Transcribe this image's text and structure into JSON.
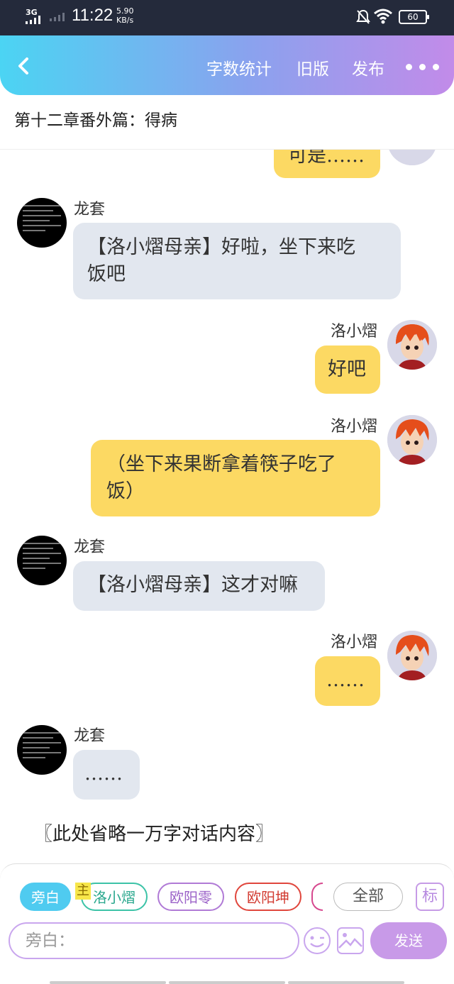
{
  "status_bar": {
    "network": "3G",
    "time": "11:22",
    "speed_value": "5.90",
    "speed_unit": "KB/s",
    "battery": "60",
    "icons": [
      "signal-icon",
      "mute-bell-icon",
      "wifi-icon",
      "battery-icon"
    ]
  },
  "header": {
    "back_icon": "chevron-left-icon",
    "word_count": "字数统计",
    "old_version": "旧版",
    "publish": "发布",
    "more_icon": "more-dots-icon"
  },
  "chapter_title": "第十二章番外篇：得病",
  "messages": [
    {
      "side": "right",
      "name": "",
      "text": "可是……",
      "partial": true
    },
    {
      "side": "left",
      "name": "龙套",
      "text_lines": [
        "【洛小熠母亲】好啦，坐下来吃",
        "饭吧"
      ]
    },
    {
      "side": "right",
      "name": "洛小熠",
      "text": "好吧"
    },
    {
      "side": "right",
      "name": "洛小熠",
      "text_lines": [
        "（坐下来果断拿着筷子吃了",
        "饭）"
      ]
    },
    {
      "side": "left",
      "name": "龙套",
      "text": "【洛小熠母亲】这才对嘛"
    },
    {
      "side": "right",
      "name": "洛小熠",
      "text": "……"
    },
    {
      "side": "left",
      "name": "龙套",
      "text": "……"
    }
  ],
  "omitted_note": "〖此处省略一万字对话内容〗",
  "bottom": {
    "chips": [
      "旁白",
      "洛小熠",
      "欧阳零",
      "欧阳坤"
    ],
    "main_tag": "主",
    "all_label": "全部",
    "mark_label": "标",
    "input_placeholder": "旁白：",
    "send_label": "发送",
    "emoji_icon": "emoji-icon",
    "image_icon": "image-icon"
  },
  "colors": {
    "header_gradient": [
      "#4bd4f3",
      "#c28be9"
    ],
    "left_bubble": "#e2e7ef",
    "right_bubble": "#fcd963",
    "send_button": "#c89ae8"
  }
}
